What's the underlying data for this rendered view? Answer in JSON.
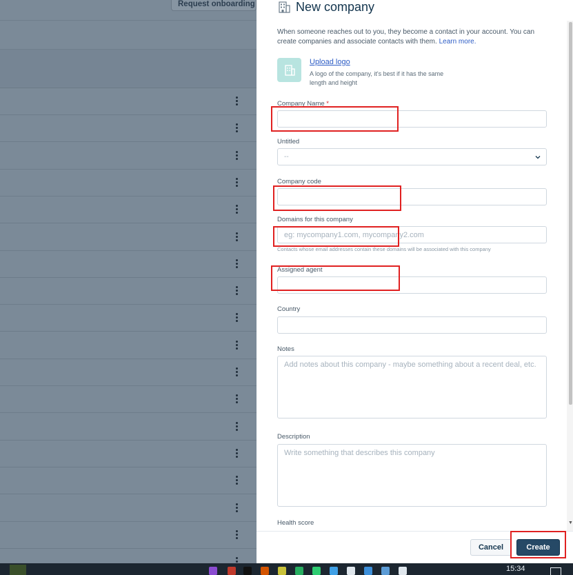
{
  "background": {
    "request_onboarding_label": "Request onboarding",
    "row_count": 18
  },
  "panel": {
    "title": "New company",
    "intro_text": "When someone reaches out to you, they become a contact in your account. You can create companies and associate contacts with them.",
    "learn_more": "Learn more.",
    "upload_logo_label": "Upload logo",
    "upload_logo_help": "A logo of the company, it's best if it has the same length and height",
    "fields": {
      "company_name": {
        "label": "Company Name",
        "required_mark": "*",
        "value": ""
      },
      "untitled": {
        "label": "Untitled",
        "value": "--"
      },
      "company_code": {
        "label": "Company code",
        "value": ""
      },
      "domains": {
        "label": "Domains for this company",
        "placeholder": "eg: mycompany1.com, mycompany2.com",
        "hint": "Contacts whose email addresses contain these domains will be associated with this company"
      },
      "assigned_agent": {
        "label": "Assigned agent",
        "value": ""
      },
      "country": {
        "label": "Country",
        "value": ""
      },
      "notes": {
        "label": "Notes",
        "placeholder": "Add notes about this company - maybe something about a recent deal, etc."
      },
      "description": {
        "label": "Description",
        "placeholder": "Write something that describes this company"
      },
      "health_score": {
        "label": "Health score"
      }
    },
    "footer": {
      "cancel_label": "Cancel",
      "create_label": "Create"
    }
  },
  "taskbar": {
    "clock": "15:34"
  },
  "colors": {
    "brand_dark": "#264966",
    "link": "#2c5cc5",
    "required": "#d72d30",
    "annotation": "#e02020",
    "overlay": "#7b8a98"
  }
}
